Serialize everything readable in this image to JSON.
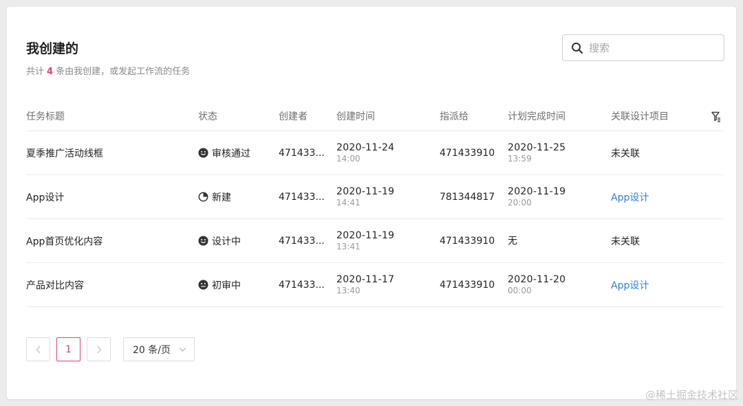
{
  "header": {
    "title": "我创建的",
    "subtitle_prefix": "共计",
    "count": "4",
    "subtitle_suffix": "条由我创建，或发起工作流的任务"
  },
  "search": {
    "placeholder": "搜索",
    "value": ""
  },
  "table": {
    "columns": [
      "任务标题",
      "状态",
      "创建者",
      "创建时间",
      "指派给",
      "计划完成时间",
      "关联设计项目"
    ],
    "rows": [
      {
        "title": "夏季推广活动线框",
        "status": "审核通过",
        "status_icon": "smiley-face-icon",
        "creator": "471433...",
        "created_date": "2020-11-24",
        "created_time": "14:00",
        "assignee": "471433910",
        "due_date": "2020-11-25",
        "due_time": "13:59",
        "project": "未关联"
      },
      {
        "title": "App设计",
        "status": "新建",
        "status_icon": "pie-clock-icon",
        "creator": "471433...",
        "created_date": "2020-11-19",
        "created_time": "14:41",
        "assignee": "781344817",
        "due_date": "2020-11-19",
        "due_time": "20:00",
        "project": "App设计"
      },
      {
        "title": "App首页优化内容",
        "status": "设计中",
        "status_icon": "smiley-face-icon",
        "creator": "471433...",
        "created_date": "2020-11-19",
        "created_time": "13:41",
        "assignee": "471433910",
        "due_date": "无",
        "due_time": "",
        "project": "未关联"
      },
      {
        "title": "产品对比内容",
        "status": "初审中",
        "status_icon": "neutral-face-icon",
        "creator": "471433...",
        "created_date": "2020-11-17",
        "created_time": "13:40",
        "assignee": "471433910",
        "due_date": "2020-11-20",
        "due_time": "00:00",
        "project": "App设计"
      }
    ]
  },
  "pagination": {
    "current_page": "1",
    "page_size": "20 条/页"
  },
  "watermark": "@稀土掘金技术社区",
  "colors": {
    "accent": "#e5416a",
    "link": "#2f7fd6"
  }
}
